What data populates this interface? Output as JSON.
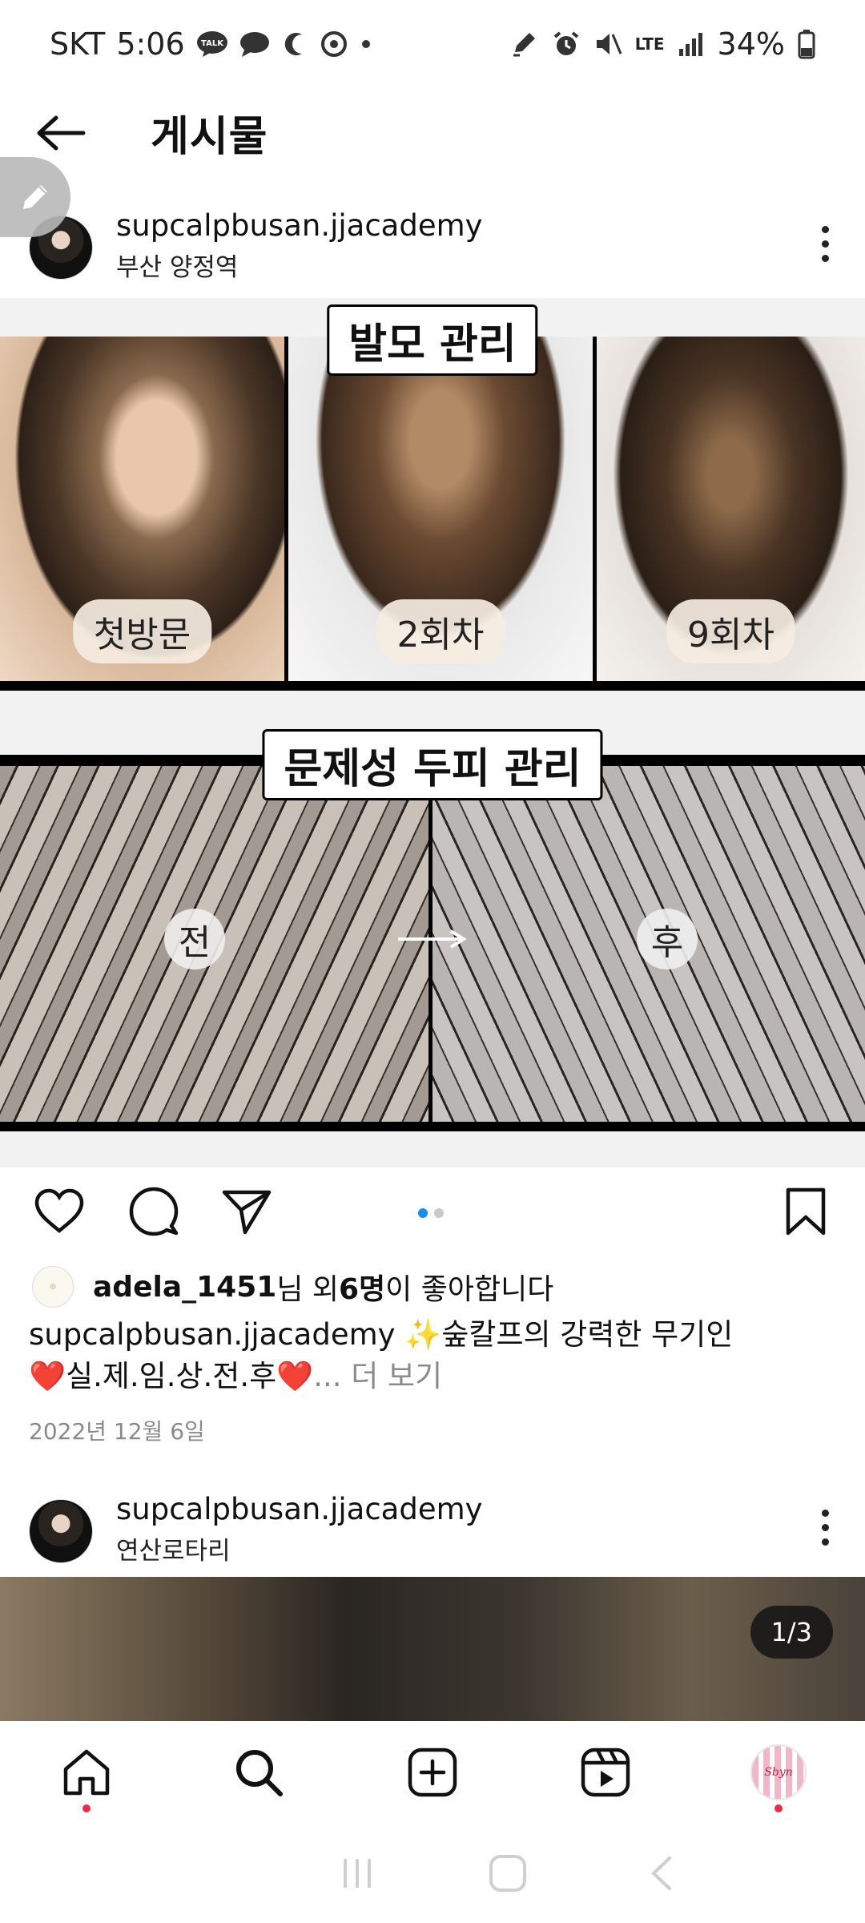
{
  "status_bar": {
    "carrier": "SKT",
    "time": "5:06",
    "network": "LTE",
    "battery": "34%",
    "icons": [
      "talk-icon",
      "message-icon",
      "moon-icon",
      "sync-icon",
      "dot-icon",
      "pen-icon",
      "alarm-icon",
      "mute-icon",
      "signal-icon",
      "battery-icon"
    ]
  },
  "app_bar": {
    "title": "게시물"
  },
  "post": {
    "username": "supcalpbusan.jjacademy",
    "location": "부산 양정역",
    "image": {
      "section1_title": "발모 관리",
      "section1_labels": [
        "첫방문",
        "2회차",
        "9회차"
      ],
      "section2_title": "문제성 두피 관리",
      "section2_before": "전",
      "section2_after": "후"
    },
    "carousel": {
      "count": 2,
      "active_index": 0
    },
    "likes": {
      "user": "adela_1451",
      "mid": "님 외 ",
      "count": "6명",
      "tail": "이 좋아합니다"
    },
    "caption": {
      "username": "supcalpbusan.jjacademy",
      "line1_text": "✨숲칼프의 강력한 무기인",
      "line2_text": "❤️실.제.임.상.전.후❤️",
      "more": "... 더 보기"
    },
    "date": "2022년 12월 6일"
  },
  "next_post": {
    "username": "supcalpbusan.jjacademy",
    "location": "연산로타리",
    "counter": "1/3"
  },
  "colors": {
    "accent_blue": "#1a8cf0",
    "notification_red": "#ee2a4a",
    "secondary_text": "#8a8a8a"
  }
}
